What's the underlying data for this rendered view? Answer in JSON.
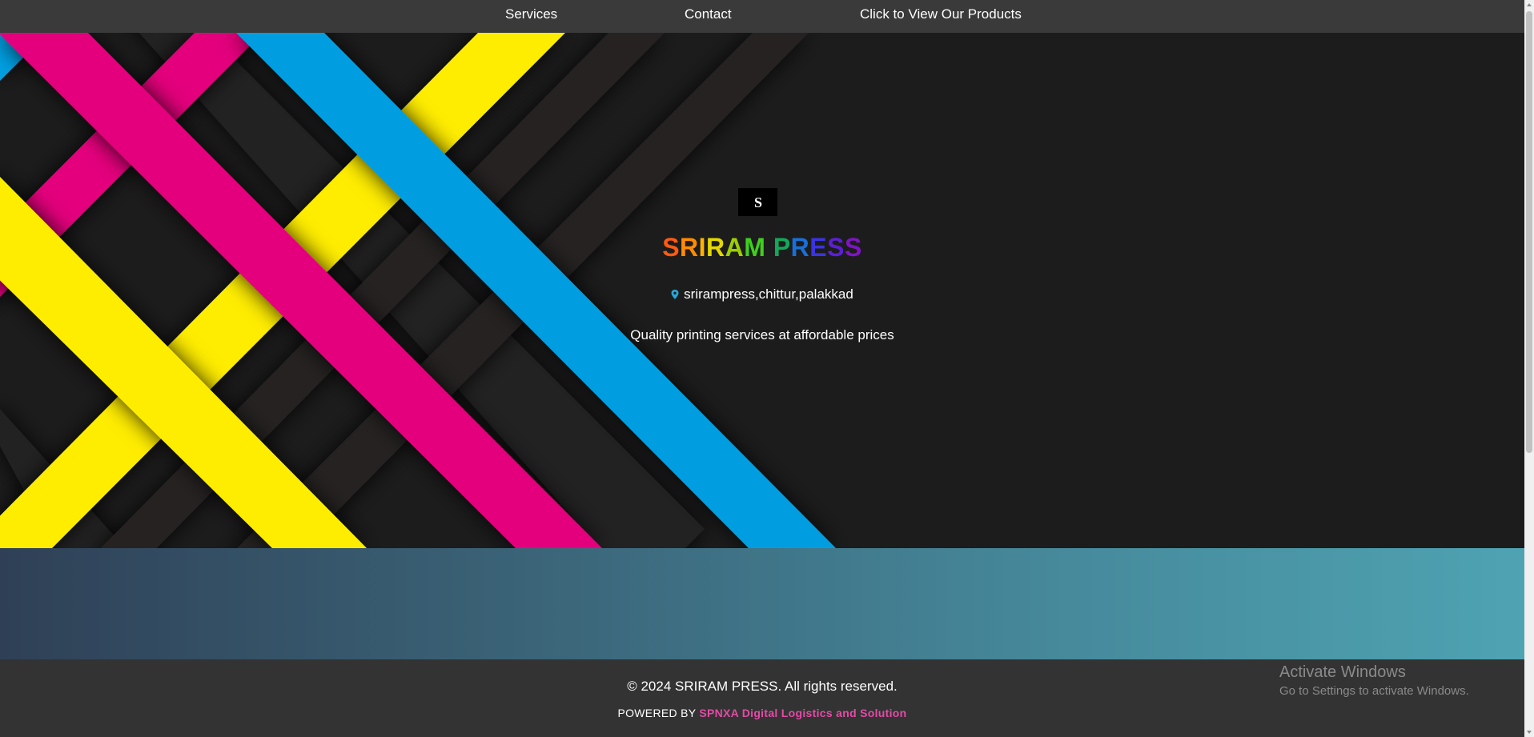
{
  "nav": {
    "services": "Services",
    "contact": "Contact",
    "products": "Click to View Our Products"
  },
  "hero": {
    "logo_letter": "S",
    "brand_letters": [
      "S",
      "R",
      "I",
      "R",
      "A",
      "M",
      " ",
      "P",
      "R",
      "E",
      "S",
      "S"
    ],
    "brand_colors": [
      "#ff5a12",
      "#ff8c00",
      "#ffb300",
      "#e4d700",
      "#9ccf00",
      "#3fcf1d",
      "#ffffff",
      "#12a85a",
      "#1a6fd6",
      "#3b34e0",
      "#5d1ed6",
      "#7e14c4"
    ],
    "location": "srirampress,chittur,palakkad",
    "tagline": "Quality printing services at affordable prices"
  },
  "footer": {
    "copyright": "© 2024 SRIRAM PRESS. All rights reserved.",
    "powered_by": "POWERED BY",
    "company": "SPNXA Digital Logistics and Solution"
  },
  "watermark": {
    "title": "Activate Windows",
    "subtitle": "Go to Settings to activate Windows."
  },
  "colors": {
    "cyan": "#009ee0",
    "magenta": "#e4007c",
    "yellow": "#ffed00",
    "dark_stripe": "#231f20"
  }
}
